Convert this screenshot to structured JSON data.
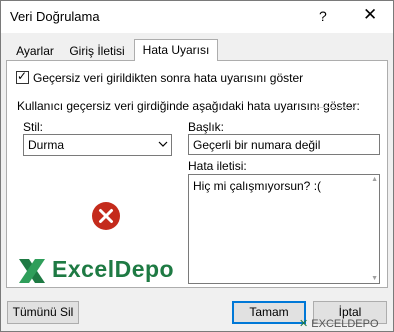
{
  "window": {
    "title": "Veri Doğrulama",
    "help_label": "?",
    "close_label": "✕"
  },
  "tabs": [
    {
      "label": "Ayarlar"
    },
    {
      "label": "Giriş İletisi"
    },
    {
      "label": "Hata Uyarısı"
    }
  ],
  "error_alert": {
    "show_alert_checkbox": {
      "label": "Geçersiz veri girildikten sonra hata uyarısını göster",
      "checked": true
    },
    "group_label": "Kullanıcı geçersiz veri girdiğinde aşağıdaki hata uyarısını göster:",
    "style": {
      "label": "Stil:",
      "value": "Durma"
    },
    "title": {
      "label": "Başlık:",
      "value": "Geçerli bir numara değil"
    },
    "message": {
      "label": "Hata iletisi:",
      "value": "Hiç mi çalışmıyorsun? :("
    },
    "icon": "error-stop-icon"
  },
  "logo": {
    "text": "ExcelDepo"
  },
  "buttons": {
    "clear_all": "Tümünü Sil",
    "ok": "Tamam",
    "cancel": "İptal"
  },
  "watermark": {
    "text": "EXCELDEPO"
  },
  "colors": {
    "error_red": "#c42b1c",
    "brand_green": "#1e7a43",
    "focus_blue": "#0078d7"
  }
}
